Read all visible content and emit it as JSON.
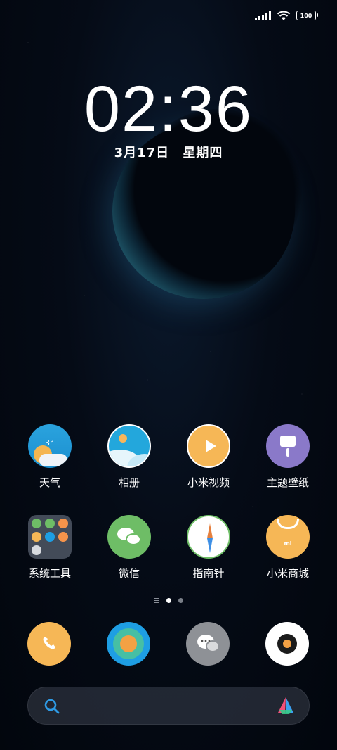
{
  "status_bar": {
    "battery": "100",
    "signal_icon": "signal-icon",
    "wifi_icon": "wifi-icon"
  },
  "lock": {
    "time": "02:36",
    "date": "3月17日",
    "weekday": "星期四"
  },
  "apps": [
    {
      "label": "天气",
      "icon": "weather-icon",
      "temp": "3°"
    },
    {
      "label": "相册",
      "icon": "gallery-icon"
    },
    {
      "label": "小米视频",
      "icon": "video-play-icon"
    },
    {
      "label": "主题壁纸",
      "icon": "theme-brush-icon"
    },
    {
      "label": "系统工具",
      "icon": "folder-icon"
    },
    {
      "label": "微信",
      "icon": "wechat-icon"
    },
    {
      "label": "指南针",
      "icon": "compass-icon"
    },
    {
      "label": "小米商城",
      "icon": "shopping-bag-icon",
      "brand": "mi"
    }
  ],
  "dock": [
    {
      "icon": "phone-icon"
    },
    {
      "icon": "browser-icon"
    },
    {
      "icon": "messages-icon"
    },
    {
      "icon": "camera-icon"
    }
  ],
  "pages": {
    "current": 2,
    "total": 2
  },
  "colors": {
    "accent_orange": "#f6b756",
    "accent_blue": "#23a7dc",
    "accent_green": "#6ebd66",
    "accent_purple": "#8a79c9"
  }
}
